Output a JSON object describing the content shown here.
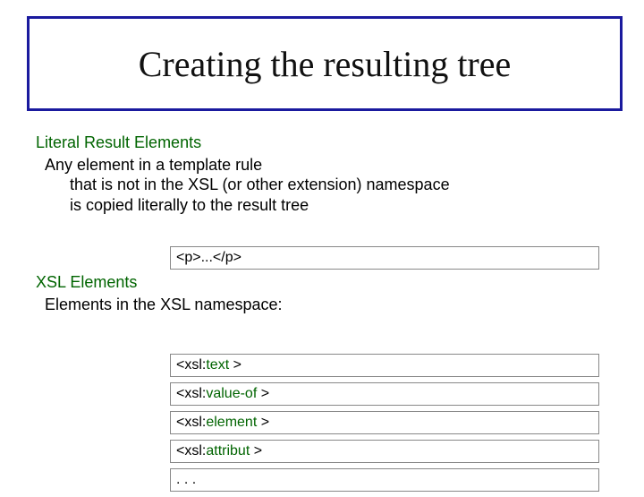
{
  "title": "Creating the resulting tree",
  "section1": {
    "head": "Literal Result Elements",
    "line1": "Any element in a template rule",
    "line2": "that is not in the XSL (or other extension) namespace",
    "line3": "is copied literally to the result tree",
    "code": "<p>...</p>"
  },
  "section2": {
    "head": "XSL Elements",
    "line1": "Elements in the XSL namespace:",
    "codes": [
      {
        "pre": "<xsl:",
        "kw": "text",
        "post": " >"
      },
      {
        "pre": "<xsl:",
        "kw": "value-of",
        "post": " >"
      },
      {
        "pre": "<xsl:",
        "kw": "element",
        "post": " >"
      },
      {
        "pre": "<xsl:",
        "kw": "attribut",
        "post": " >"
      },
      {
        "pre": ". . .",
        "kw": "",
        "post": ""
      }
    ]
  }
}
